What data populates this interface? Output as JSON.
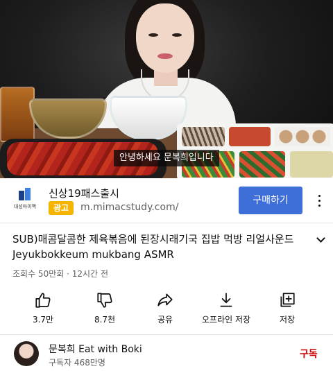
{
  "video": {
    "subtitle": "안녕하세요 문복희입니다"
  },
  "ad": {
    "logo_text": "대성마이맥",
    "title": "신상19패스출시",
    "badge": "광고",
    "url": "m.mimacstudy.com/",
    "cta_label": "구매하기",
    "more_icon": "more-vertical-icon",
    "cta_color": "#3e6fd8",
    "badge_color": "#f4b400"
  },
  "video_info": {
    "title": "SUB)매콤달콤한 제육볶음에 된장시래기국 집밥 먹방 리얼사운드 Jeyukbokkeum mukbang ASMR",
    "views": "조회수 50만회",
    "separator": "·",
    "age": "12시간 전",
    "expand_icon": "chevron-down-icon"
  },
  "actions": [
    {
      "label": "3.7만",
      "icon": "thumbs-up-icon"
    },
    {
      "label": "8.7천",
      "icon": "thumbs-down-icon"
    },
    {
      "label": "공유",
      "icon": "share-icon"
    },
    {
      "label": "오프라인 저장",
      "icon": "download-icon"
    },
    {
      "label": "저장",
      "icon": "add-to-playlist-icon"
    }
  ],
  "channel": {
    "name": "문복희 Eat with Boki",
    "subscribers": "구독자 468만명",
    "subscribe_label": "구독",
    "subscribe_color": "#cc0000"
  }
}
